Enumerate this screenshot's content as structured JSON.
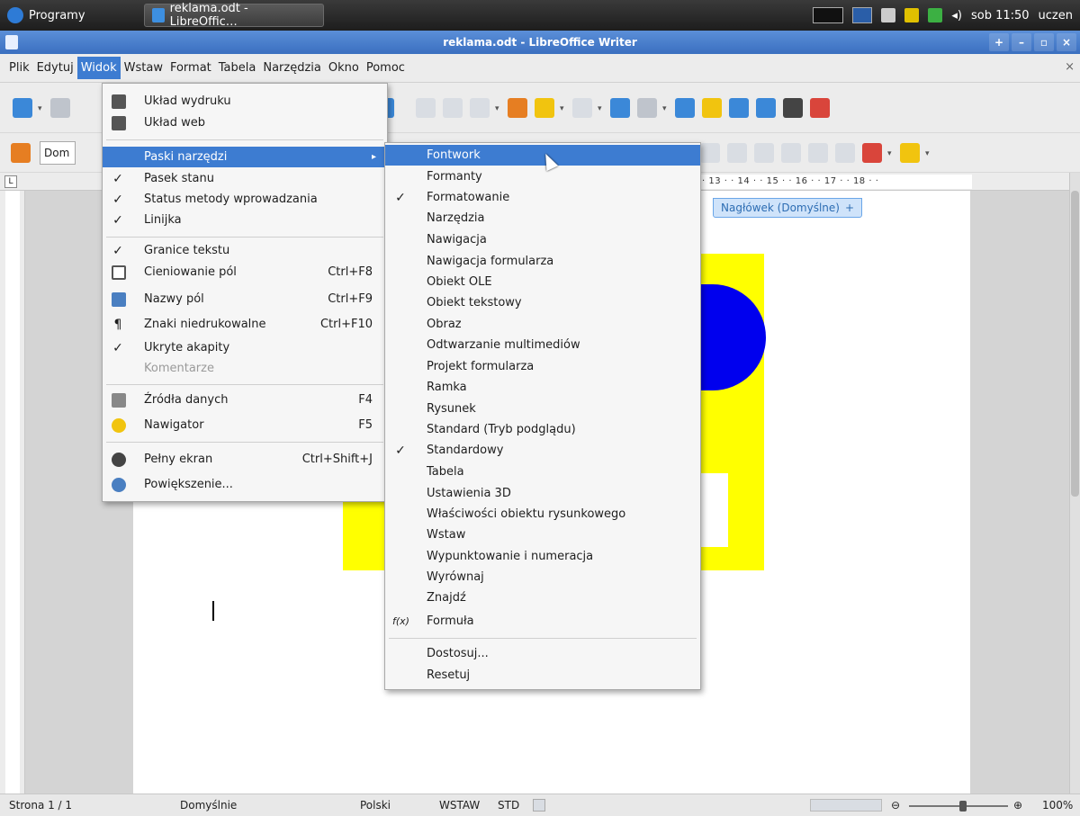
{
  "taskbar": {
    "programs": "Programy",
    "task": "reklama.odt - LibreOffic…",
    "clock": "sob 11:50",
    "user": "uczen"
  },
  "window": {
    "title": "reklama.odt - LibreOffice Writer",
    "controls": [
      "+",
      "–",
      "▫",
      "×"
    ]
  },
  "menubar": {
    "items": [
      "Plik",
      "Edytuj",
      "Widok",
      "Wstaw",
      "Format",
      "Tabela",
      "Narzędzia",
      "Okno",
      "Pomoc"
    ],
    "close": "×"
  },
  "toolbar2": {
    "style_value": "Dom"
  },
  "ruler": {
    "ticks": "· 13 · · 14 · · 15 · · 16 · · 17 · · 18 · ·",
    "tab_symbol": "L"
  },
  "document": {
    "header_tag": "Nagłówek (Domyślne)",
    "header_plus": "+"
  },
  "view_menu": {
    "items": [
      {
        "label": "Układ wydruku",
        "shortcut": "",
        "mark": "icon"
      },
      {
        "label": "Układ web",
        "shortcut": "",
        "mark": "icon"
      },
      {
        "label": "Paski narzędzi",
        "shortcut": "",
        "mark": "",
        "submenu": "▸"
      },
      {
        "label": "Pasek stanu",
        "shortcut": "",
        "mark": "✓"
      },
      {
        "label": "Status metody wprowadzania",
        "shortcut": "",
        "mark": "✓"
      },
      {
        "label": "Linijka",
        "shortcut": "",
        "mark": "✓"
      },
      {
        "label": "Granice tekstu",
        "shortcut": "",
        "mark": "✓"
      },
      {
        "label": "Cieniowanie pól",
        "shortcut": "Ctrl+F8",
        "mark": "icon"
      },
      {
        "label": "Nazwy pól",
        "shortcut": "Ctrl+F9",
        "mark": "icon"
      },
      {
        "label": "Znaki niedrukowalne",
        "shortcut": "Ctrl+F10",
        "mark": "¶"
      },
      {
        "label": "Ukryte akapity",
        "shortcut": "",
        "mark": "✓"
      },
      {
        "label": "Komentarze",
        "shortcut": "",
        "mark": ""
      },
      {
        "label": "Źródła danych",
        "shortcut": "F4",
        "mark": "icon"
      },
      {
        "label": "Nawigator",
        "shortcut": "F5",
        "mark": "icon"
      },
      {
        "label": "Pełny ekran",
        "shortcut": "Ctrl+Shift+J",
        "mark": "icon"
      },
      {
        "label": "Powiększenie...",
        "shortcut": "",
        "mark": "icon"
      }
    ]
  },
  "toolbars_menu": {
    "items": [
      {
        "label": "Fontwork",
        "mark": ""
      },
      {
        "label": "Formanty",
        "mark": ""
      },
      {
        "label": "Formatowanie",
        "mark": "✓"
      },
      {
        "label": "Narzędzia",
        "mark": ""
      },
      {
        "label": "Nawigacja",
        "mark": ""
      },
      {
        "label": "Nawigacja formularza",
        "mark": ""
      },
      {
        "label": "Obiekt OLE",
        "mark": ""
      },
      {
        "label": "Obiekt tekstowy",
        "mark": ""
      },
      {
        "label": "Obraz",
        "mark": ""
      },
      {
        "label": "Odtwarzanie multimediów",
        "mark": ""
      },
      {
        "label": "Projekt formularza",
        "mark": ""
      },
      {
        "label": "Ramka",
        "mark": ""
      },
      {
        "label": "Rysunek",
        "mark": ""
      },
      {
        "label": "Standard (Tryb podglądu)",
        "mark": ""
      },
      {
        "label": "Standardowy",
        "mark": "✓"
      },
      {
        "label": "Tabela",
        "mark": ""
      },
      {
        "label": "Ustawienia 3D",
        "mark": ""
      },
      {
        "label": "Właściwości obiektu rysunkowego",
        "mark": ""
      },
      {
        "label": "Wstaw",
        "mark": ""
      },
      {
        "label": "Wypunktowanie i numeracja",
        "mark": ""
      },
      {
        "label": "Wyrównaj",
        "mark": ""
      },
      {
        "label": "Znajdź",
        "mark": ""
      },
      {
        "label": "Formuła",
        "mark": "f(x)"
      },
      {
        "label": "Dostosuj...",
        "mark": ""
      },
      {
        "label": "Resetuj",
        "mark": ""
      }
    ]
  },
  "statusbar": {
    "page": "Strona 1 / 1",
    "style": "Domyślnie",
    "language": "Polski",
    "insert_mode": "WSTAW",
    "selection_mode": "STD",
    "zoom": "100%"
  }
}
